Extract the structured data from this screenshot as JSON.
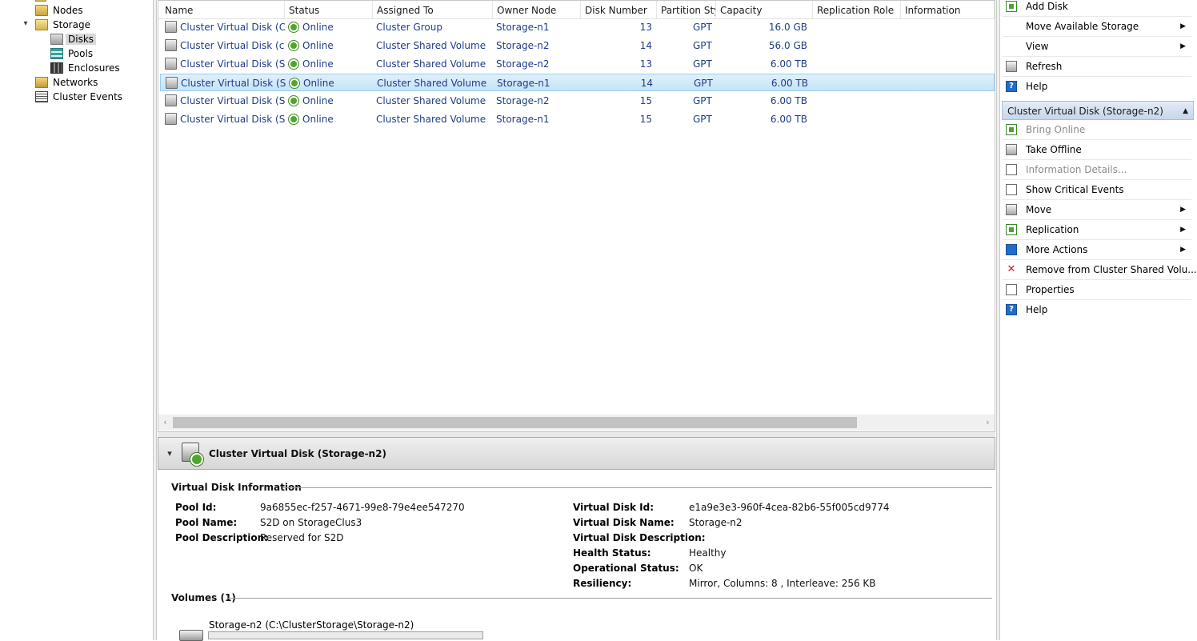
{
  "tree": {
    "items": [
      {
        "label": "Nodes",
        "icon": "node-icon"
      },
      {
        "label": "Storage",
        "icon": "storage-folder-icon",
        "expanded": true
      },
      {
        "label": "Disks",
        "icon": "disks-icon",
        "selected": true
      },
      {
        "label": "Pools",
        "icon": "pools-icon"
      },
      {
        "label": "Enclosures",
        "icon": "enclosures-icon"
      },
      {
        "label": "Networks",
        "icon": "networks-icon"
      },
      {
        "label": "Cluster Events",
        "icon": "cluster-events-icon"
      }
    ]
  },
  "list": {
    "columns": [
      "Name",
      "Status",
      "Assigned To",
      "Owner Node",
      "Disk Number",
      "Partition Style",
      "Capacity",
      "Replication Role",
      "Information"
    ],
    "rows": [
      {
        "name": "Cluster Virtual Disk (Clust...",
        "status": "Online",
        "assigned": "Cluster Group",
        "owner": "Storage-n1",
        "disk": "13",
        "partition": "GPT",
        "capacity": "16.0 GB",
        "selected": false
      },
      {
        "name": "Cluster Virtual Disk (colle...",
        "status": "Online",
        "assigned": "Cluster Shared Volume",
        "owner": "Storage-n2",
        "disk": "14",
        "partition": "GPT",
        "capacity": "56.0 GB",
        "selected": false
      },
      {
        "name": "Cluster Virtual Disk (Stor...",
        "status": "Online",
        "assigned": "Cluster Shared Volume",
        "owner": "Storage-n2",
        "disk": "13",
        "partition": "GPT",
        "capacity": "6.00 TB",
        "selected": false
      },
      {
        "name": "Cluster Virtual Disk (Stor...",
        "status": "Online",
        "assigned": "Cluster Shared Volume",
        "owner": "Storage-n1",
        "disk": "14",
        "partition": "GPT",
        "capacity": "6.00 TB",
        "selected": true
      },
      {
        "name": "Cluster Virtual Disk (Stor...",
        "status": "Online",
        "assigned": "Cluster Shared Volume",
        "owner": "Storage-n2",
        "disk": "15",
        "partition": "GPT",
        "capacity": "6.00 TB",
        "selected": false
      },
      {
        "name": "Cluster Virtual Disk (Stor...",
        "status": "Online",
        "assigned": "Cluster Shared Volume",
        "owner": "Storage-n1",
        "disk": "15",
        "partition": "GPT",
        "capacity": "6.00 TB",
        "selected": false
      }
    ],
    "scroll_left_glyph": "‹",
    "scroll_right_glyph": "›"
  },
  "details": {
    "title": "Cluster Virtual Disk (Storage-n2)",
    "section_info": "Virtual Disk Information",
    "left": [
      {
        "label": "Pool Id:",
        "value": "9a6855ec-f257-4671-99e8-79e4ee547270"
      },
      {
        "label": "Pool Name:",
        "value": "S2D on StorageClus3"
      },
      {
        "label": "Pool Description:",
        "value": "Reserved for S2D"
      }
    ],
    "right": [
      {
        "label": "Virtual Disk Id:",
        "value": "e1a9e3e3-960f-4cea-82b6-55f005cd9774"
      },
      {
        "label": "Virtual Disk Name:",
        "value": "Storage-n2"
      },
      {
        "label": "Virtual Disk Description:",
        "value": ""
      },
      {
        "label": "Health Status:",
        "value": "Healthy"
      },
      {
        "label": "Operational Status:",
        "value": "OK"
      },
      {
        "label": "Resiliency:",
        "value": "Mirror, Columns: 8 , Interleave: 256 KB"
      }
    ],
    "section_volumes": "Volumes (1)",
    "volume": {
      "label": "Storage-n2 (C:\\ClusterStorage\\Storage-n2)",
      "used_fraction": 0.0
    }
  },
  "actions": {
    "top": [
      {
        "label": "Add Disk",
        "icon": "add-disk-icon",
        "submenu": false,
        "disabled": false
      },
      {
        "label": "Move Available Storage",
        "icon": "",
        "submenu": true,
        "disabled": false
      },
      {
        "label": "View",
        "icon": "",
        "submenu": true,
        "disabled": false
      },
      {
        "label": "Refresh",
        "icon": "refresh-icon",
        "submenu": false,
        "disabled": false
      },
      {
        "label": "Help",
        "icon": "help-icon",
        "submenu": false,
        "disabled": false
      }
    ],
    "section_title": "Cluster Virtual Disk (Storage-n2)",
    "section": [
      {
        "label": "Bring Online",
        "icon": "bring-online-icon",
        "submenu": false,
        "disabled": true
      },
      {
        "label": "Take Offline",
        "icon": "take-offline-icon",
        "submenu": false,
        "disabled": false
      },
      {
        "label": "Information Details...",
        "icon": "information-details-icon",
        "submenu": false,
        "disabled": true
      },
      {
        "label": "Show Critical Events",
        "icon": "critical-events-icon",
        "submenu": false,
        "disabled": false
      },
      {
        "label": "Move",
        "icon": "move-icon",
        "submenu": true,
        "disabled": false
      },
      {
        "label": "Replication",
        "icon": "replication-icon",
        "submenu": true,
        "disabled": false
      },
      {
        "label": "More Actions",
        "icon": "more-actions-icon",
        "submenu": true,
        "disabled": false
      },
      {
        "label": "Remove from Cluster Shared Volu...",
        "icon": "remove-csv-icon",
        "submenu": false,
        "disabled": false
      },
      {
        "label": "Properties",
        "icon": "properties-icon",
        "submenu": false,
        "disabled": false
      },
      {
        "label": "Help",
        "icon": "help-icon",
        "submenu": false,
        "disabled": false
      }
    ],
    "submenu_glyph": "▶",
    "collapse_glyph": "▲",
    "help_glyph": "?"
  },
  "colors": {
    "selection": "#c5e4f7",
    "link": "#1f3c88",
    "status_ok": "#4fa62c"
  }
}
